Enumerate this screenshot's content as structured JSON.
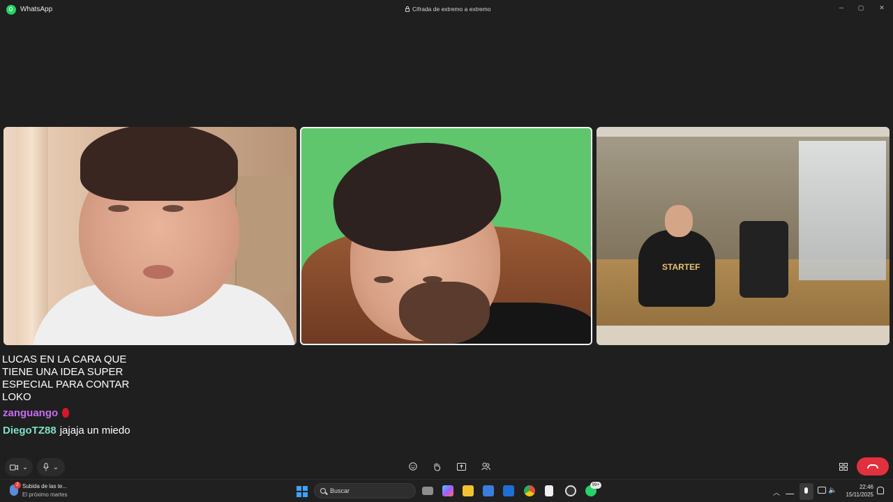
{
  "titlebar": {
    "app_name": "WhatsApp",
    "encryption_label": "Cifrada de extremo a extremo",
    "minimize": "─",
    "maximize": "▢",
    "close": "✕"
  },
  "video_tiles": [
    {
      "shirt_text": ""
    },
    {
      "shirt_text": ""
    },
    {
      "shirt_text": "STARTEF"
    }
  ],
  "captions": {
    "overlay_text": "LUCAS EN LA CARA QUE TIENE UNA IDEA SUPER ESPECIAL PARA CONTAR LOKO",
    "chat": [
      {
        "user": "zanguango",
        "message": ""
      },
      {
        "user": "DiegoTZ88",
        "message": "jajaja un miedo"
      }
    ]
  },
  "call_toolbar": {
    "camera_icon": "camera-icon",
    "mic_icon": "mic-icon",
    "chevron": "⌄",
    "emoji_icon": "emoji-icon",
    "raise_hand_icon": "raise-hand-icon",
    "share_screen_icon": "share-screen-icon",
    "add_participant_icon": "add-participant-icon",
    "layout_icon": "layout-icon",
    "end_call_color": "#e0313d"
  },
  "taskbar": {
    "weather_title": "Subida de las te...",
    "weather_subtitle": "El próximo martes",
    "weather_badge": "2",
    "search_placeholder": "Buscar",
    "whatsapp_badge": "99+",
    "time": "22:46",
    "date": "15/11/2025"
  },
  "colors": {
    "accent_whatsapp": "#25d366",
    "chat_user_purple": "#c56df0",
    "chat_user_teal": "#7fe0c6"
  }
}
